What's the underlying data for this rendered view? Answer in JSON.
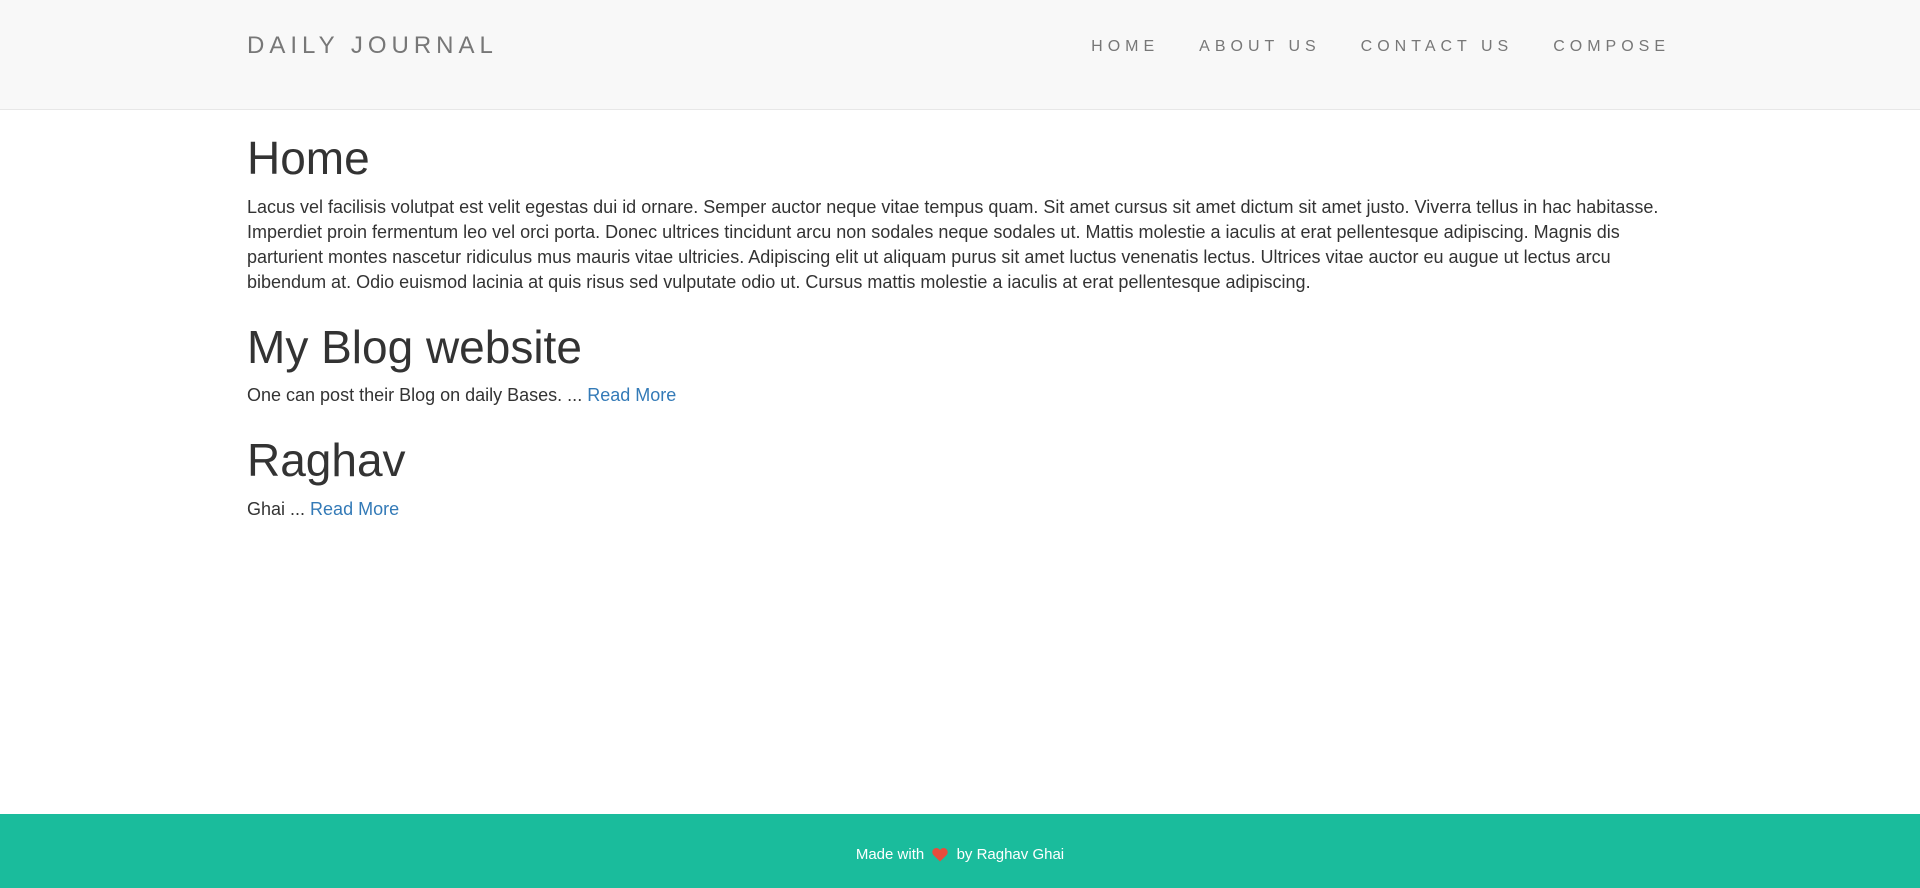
{
  "header": {
    "brand": "DAILY JOURNAL",
    "nav": [
      {
        "label": "HOME"
      },
      {
        "label": "ABOUT US"
      },
      {
        "label": "CONTACT US"
      },
      {
        "label": "COMPOSE"
      }
    ]
  },
  "home": {
    "title": "Home",
    "content": "Lacus vel facilisis volutpat est velit egestas dui id ornare. Semper auctor neque vitae tempus quam. Sit amet cursus sit amet dictum sit amet justo. Viverra tellus in hac habitasse. Imperdiet proin fermentum leo vel orci porta. Donec ultrices tincidunt arcu non sodales neque sodales ut. Mattis molestie a iaculis at erat pellentesque adipiscing. Magnis dis parturient montes nascetur ridiculus mus mauris vitae ultricies. Adipiscing elit ut aliquam purus sit amet luctus venenatis lectus. Ultrices vitae auctor eu augue ut lectus arcu bibendum at. Odio euismod lacinia at quis risus sed vulputate odio ut. Cursus mattis molestie a iaculis at erat pellentesque adipiscing."
  },
  "posts": [
    {
      "title": "My Blog website",
      "excerpt": "One can post their Blog on daily Bases. ...",
      "link_label": "Read More"
    },
    {
      "title": "Raghav",
      "excerpt": "Ghai ...",
      "link_label": "Read More"
    }
  ],
  "footer": {
    "prefix": "Made with",
    "suffix": "by Raghav Ghai",
    "heart_icon": "heart-icon",
    "heart_color": "#e74c3c",
    "background": "#1abc9c"
  }
}
